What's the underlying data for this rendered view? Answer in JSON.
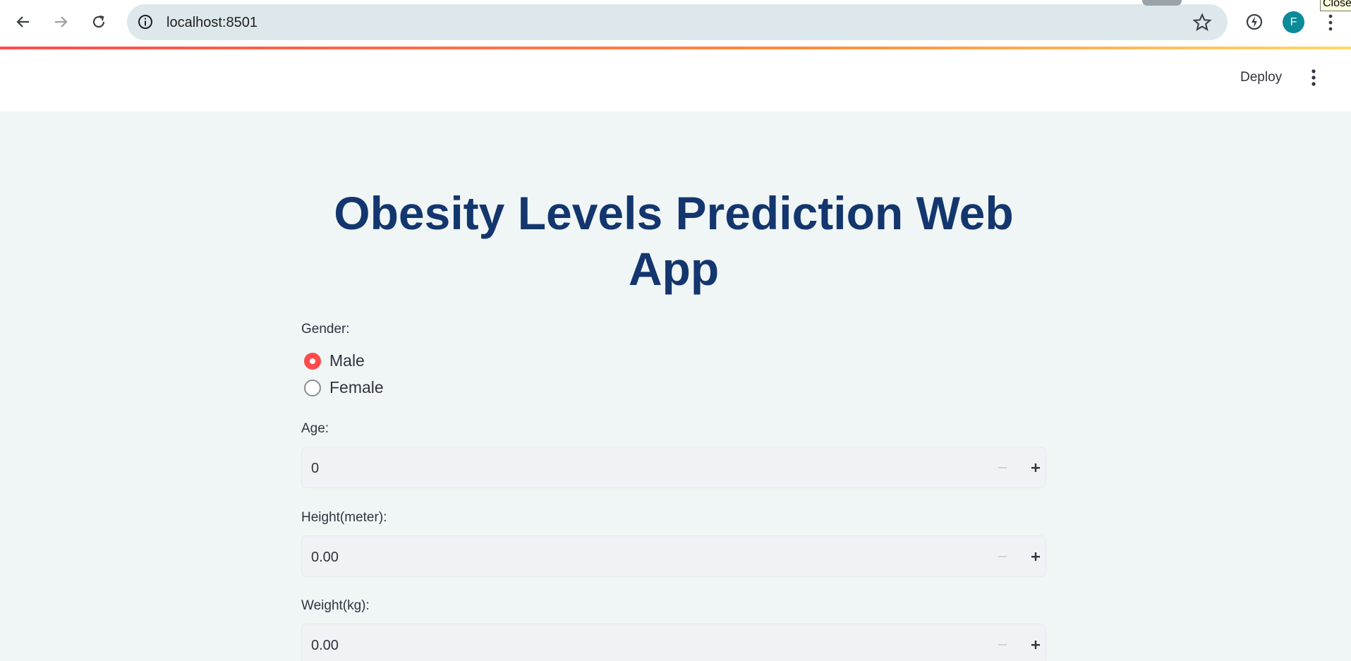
{
  "browser": {
    "url": "localhost:8501",
    "avatar_letter": "F",
    "tooltip": "Close"
  },
  "header": {
    "deploy_label": "Deploy"
  },
  "main": {
    "title": "Obesity Levels Prediction Web App",
    "gender": {
      "label": "Gender:",
      "options": [
        "Male",
        "Female"
      ],
      "selected": "Male"
    },
    "age": {
      "label": "Age:",
      "value": "0"
    },
    "height": {
      "label": "Height(meter):",
      "value": "0.00"
    },
    "weight": {
      "label": "Weight(kg):",
      "value": "0.00"
    }
  },
  "colors": {
    "accent": "#ff4b4b",
    "title": "#14366e",
    "background": "#f0f6f6"
  }
}
